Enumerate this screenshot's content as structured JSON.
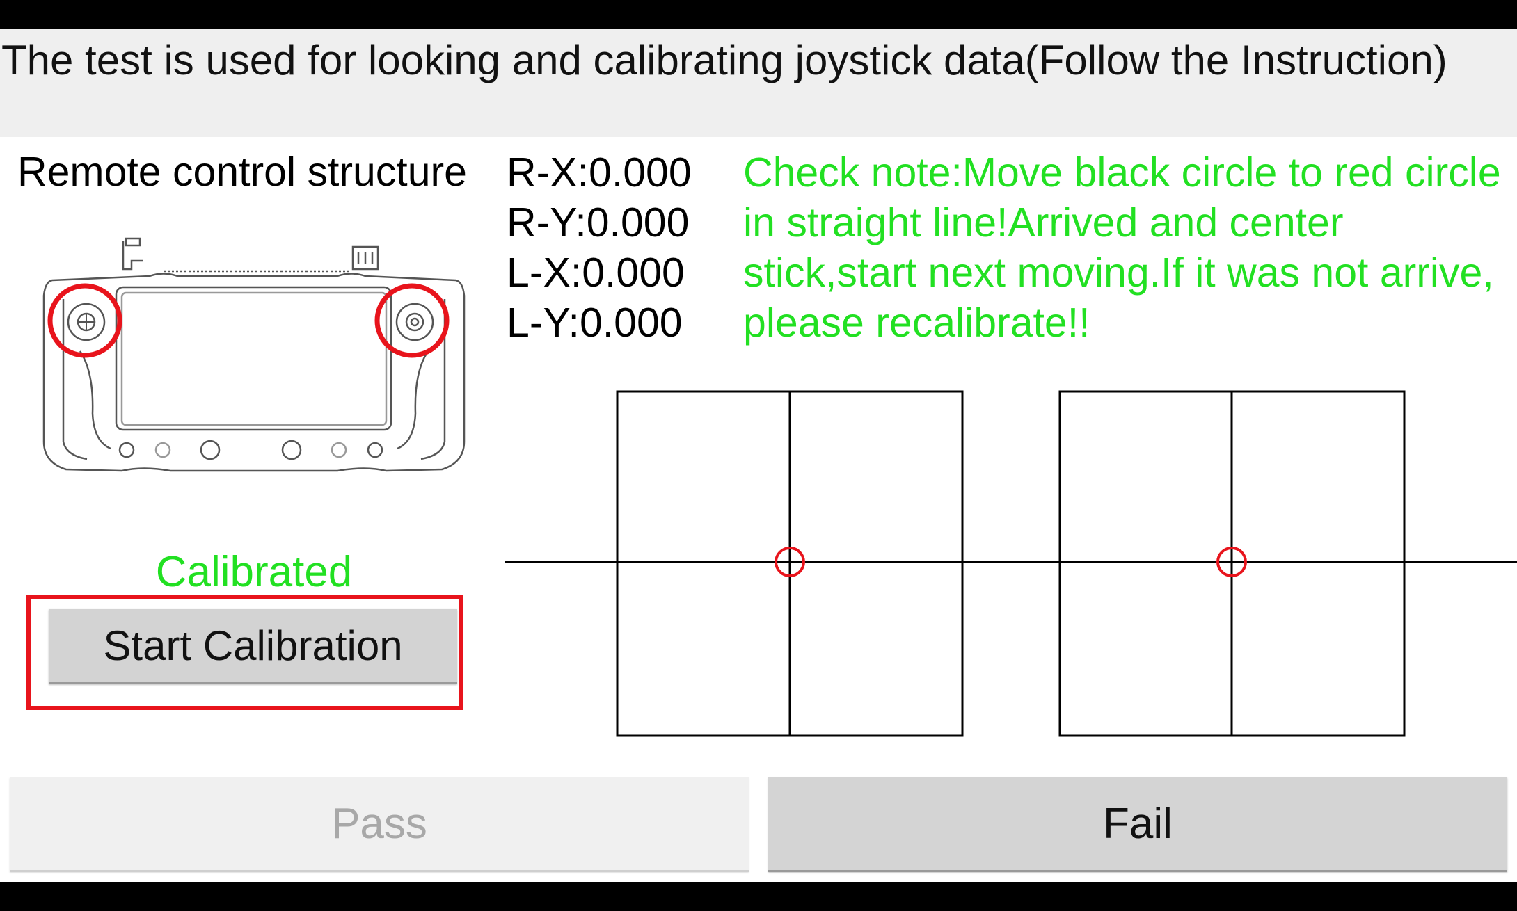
{
  "header": {
    "title": "The test is used for looking and calibrating joystick data(Follow the Instruction)"
  },
  "structure": {
    "title": "Remote control structure"
  },
  "readouts": {
    "rx": "R-X:0.000",
    "ry": "R-Y:0.000",
    "lx": "L-X:0.000",
    "ly": "L-Y:0.000"
  },
  "note": {
    "text": "Check note:Move black circle to red circle in straight line!Arrived and center stick,start next moving.If it was not arrive, please recalibrate!!",
    "color": "#22e022"
  },
  "calibration": {
    "status": "Calibrated",
    "button_label": "Start Calibration"
  },
  "actions": {
    "pass_label": "Pass",
    "fail_label": "Fail"
  },
  "colors": {
    "highlight": "#e8141c",
    "target_circle": "#e8141c"
  }
}
